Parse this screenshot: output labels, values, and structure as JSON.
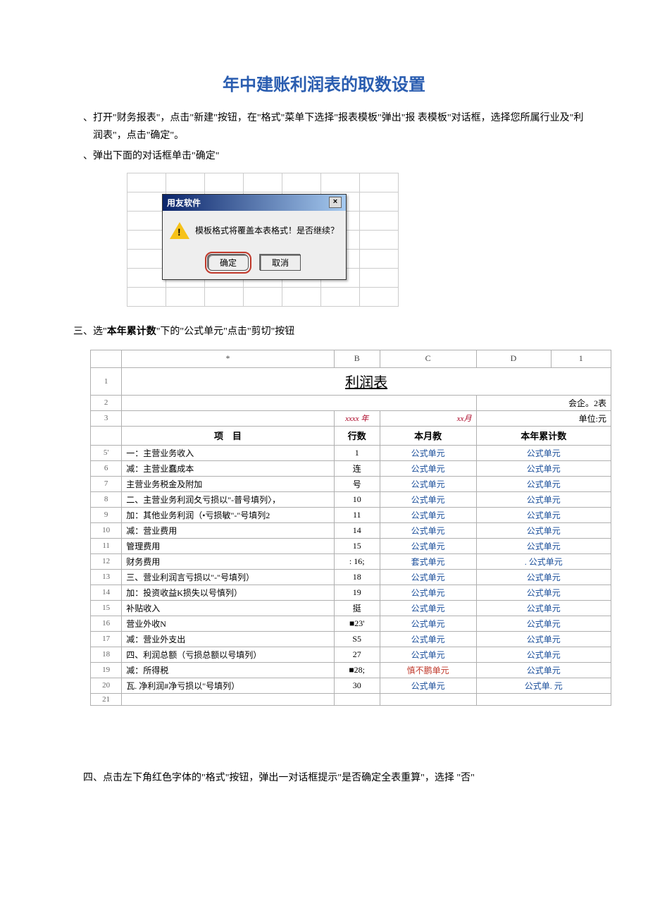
{
  "title": "年中建账利润表的取数设置",
  "steps": {
    "s1": "、打开\"财务报表\"，点击\"新建\"按钮，在\"格式\"菜单下选择\"报表模板\"弹出\"报 表模板\"对话框，选择您所属行业及\"利润表\"，点击\"确定\"。",
    "s2": "、弹出下面的对话框单击\"确定\"",
    "s3_prefix": "三、选\"",
    "s3_bold": "本年累计数",
    "s3_suffix": "\"下的\"公式单元\"点击\"剪切\"按钮",
    "s4": "四、点击左下角红色字体的\"格式\"按钮，弹出一对话框提示\"是否确定全表重算\"，选择 \"否\""
  },
  "dialog": {
    "title": "用友软件",
    "msg": "模板格式将覆盖本表格式！是否继续？",
    "ok": "确定",
    "cancel": "取消"
  },
  "sheet": {
    "colA": "*",
    "colB": "B",
    "colC": "C",
    "colD": "D",
    "colE": "1",
    "title": "利润表",
    "top_right": "会企。2表",
    "year": "xxxx 年",
    "month": "xx月",
    "unit": "单位:元",
    "hdr_proj": "项　目",
    "hdr_row": "行数",
    "hdr_mm": "本月教",
    "hdr_yy": "本年累计数",
    "formula": "公式单元",
    "formula_alt1": "套式单元",
    "formula_alt2": ". 公式单元",
    "formula_alt3": "慎不鹏单元",
    "formula_alt4": "公式单. 元",
    "rows": [
      {
        "n": "5'",
        "proj": "一：主营业务收入",
        "row": "1",
        "mm": "公式单元",
        "yy": "公式单元",
        "cls": ""
      },
      {
        "n": "6",
        "proj": "减：主营业蠢成本",
        "row": "连",
        "mm": "公式单元",
        "yy": "公式单元",
        "cls": "indent1"
      },
      {
        "n": "7",
        "proj": "主营业务税金及附加",
        "row": "号",
        "mm": "公式单元",
        "yy": "公式单元",
        "cls": "indent2"
      },
      {
        "n": "8",
        "proj": "二、主营业务利润夂亏损以\"-普号填列〉，",
        "row": "10",
        "mm": "公式单元",
        "yy": "公式单元",
        "cls": ""
      },
      {
        "n": "9",
        "proj": "加：其他业务利润（•亏损敏\"-\"号填列2",
        "row": "11",
        "mm": "公式单元",
        "yy": "公式单元",
        "cls": "indent1"
      },
      {
        "n": "10",
        "proj": "减：营业费用",
        "row": "14",
        "mm": "公式单元",
        "yy": "公式单元",
        "cls": "indent1"
      },
      {
        "n": "11",
        "proj": "管理费用",
        "row": "15",
        "mm": "公式单元",
        "yy": "公式单元",
        "cls": "indent2"
      },
      {
        "n": "12",
        "proj": "财务费用",
        "row": ": 16;",
        "mm": "套式单元",
        "yy": ". 公式单元",
        "cls": "indent2"
      },
      {
        "n": "13",
        "proj": "三、营业利润言亏损以\"-\"号填列）",
        "row": "18",
        "mm": "公式单元",
        "yy": "公式单元",
        "cls": ""
      },
      {
        "n": "14",
        "proj": "加：投资收益K损失以号慎列）",
        "row": "19",
        "mm": "公式单元",
        "yy": "公式单元",
        "cls": "indent1"
      },
      {
        "n": "15",
        "proj": "补贴收入",
        "row": "挺",
        "mm": "公式单元",
        "yy": "公式单元",
        "cls": "indent2"
      },
      {
        "n": "16",
        "proj": "营业外收N",
        "row": "■23'",
        "mm": "公式单元",
        "yy": "公式单元",
        "cls": "indent2"
      },
      {
        "n": "17",
        "proj": "减：营业外支出",
        "row": "S5",
        "mm": "公式单元",
        "yy": "公式单元",
        "cls": "indent1"
      },
      {
        "n": "18",
        "proj": "四、利润总额（亏损总额以号填列）",
        "row": "27",
        "mm": "公式单元",
        "yy": "公式单元",
        "cls": ""
      },
      {
        "n": "19",
        "proj": "减：所得税",
        "row": "■28;",
        "mm": "慎不鹏单元",
        "yy": "公式单元",
        "cls": "indent1"
      },
      {
        "n": "20",
        "proj": "瓦. 净利润#净亏损以\"号填列）",
        "row": "30",
        "mm": "公式单元",
        "yy": "公式单. 元",
        "cls": ""
      },
      {
        "n": "21",
        "proj": "",
        "row": "",
        "mm": "",
        "yy": "",
        "cls": ""
      }
    ]
  }
}
